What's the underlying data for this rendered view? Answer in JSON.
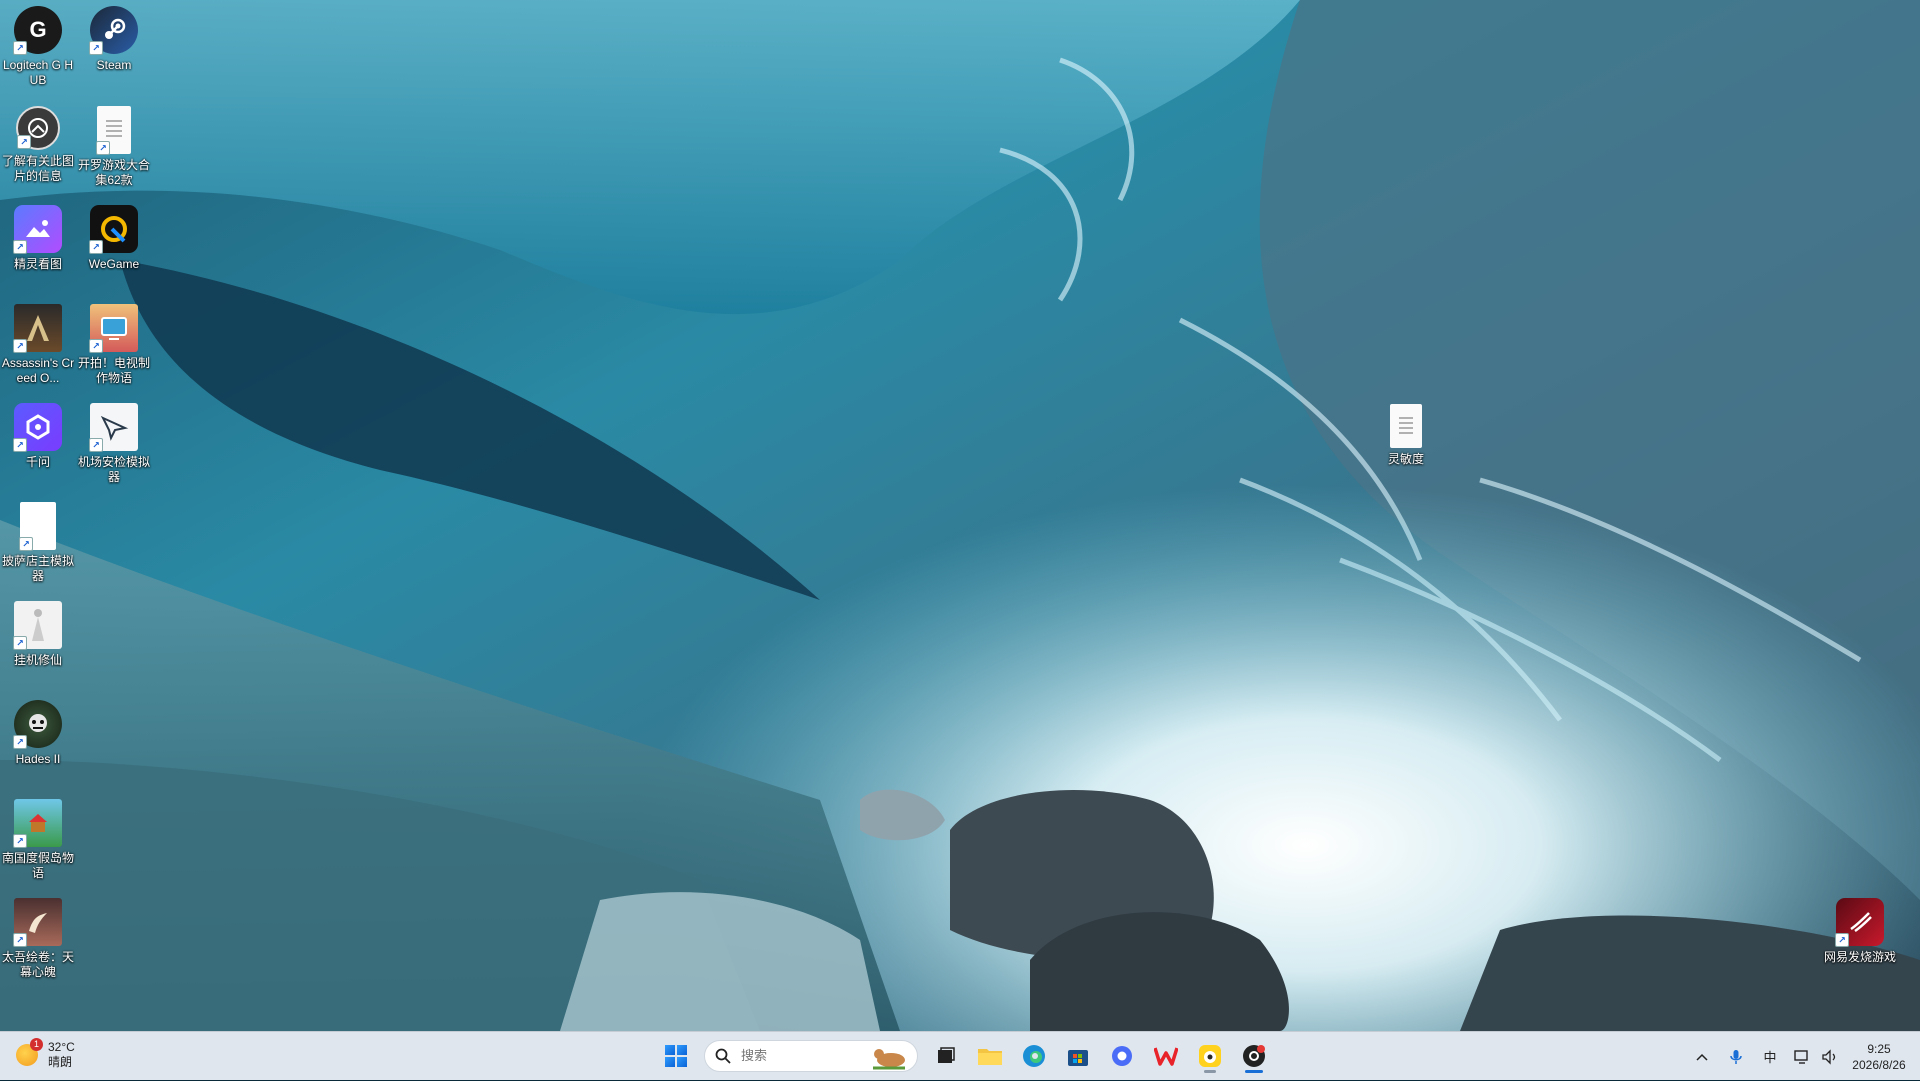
{
  "desktop": {
    "icons": [
      {
        "label": "Logitech G HUB",
        "icon": "logitech-g-hub-icon"
      },
      {
        "label": "Steam",
        "icon": "steam-icon"
      },
      {
        "label": "了解有关此图片的信息",
        "icon": "spotlight-info-icon"
      },
      {
        "label": "开罗游戏大合集62款",
        "icon": "text-file-icon"
      },
      {
        "label": "精灵看图",
        "icon": "image-viewer-icon"
      },
      {
        "label": "WeGame",
        "icon": "wegame-icon"
      },
      {
        "label": "Assassin's Creed O...",
        "icon": "assassins-creed-icon"
      },
      {
        "label": "开拍！电视制作物语",
        "icon": "kairo-tv-game-icon"
      },
      {
        "label": "千问",
        "icon": "qianwen-icon"
      },
      {
        "label": "机场安检模拟器",
        "icon": "airport-simulator-icon"
      },
      {
        "label": "披萨店主模拟器",
        "icon": "blank-file-icon"
      },
      {
        "label": "挂机修仙",
        "icon": "idle-cultivation-icon"
      },
      {
        "label": "Hades II",
        "icon": "hades-icon"
      },
      {
        "label": "南国度假岛物语",
        "icon": "resort-island-icon"
      },
      {
        "label": "太吾绘卷：天幕心魄",
        "icon": "taiwu-icon"
      },
      {
        "label": "灵敏度",
        "icon": "text-file-icon"
      },
      {
        "label": "网易发烧游戏",
        "icon": "netease-game-icon"
      }
    ]
  },
  "taskbar": {
    "weather": {
      "temp": "32°C",
      "condition": "晴朗",
      "badge": "1"
    },
    "search": {
      "placeholder": "搜索"
    },
    "apps": [
      {
        "name": "start",
        "icon": "windows-start-icon"
      },
      {
        "name": "task-view",
        "icon": "task-view-icon"
      },
      {
        "name": "file-explorer",
        "icon": "folder-icon"
      },
      {
        "name": "edge",
        "icon": "edge-icon"
      },
      {
        "name": "store",
        "icon": "microsoft-store-icon"
      },
      {
        "name": "browser",
        "icon": "blue-circle-app-icon"
      },
      {
        "name": "wps",
        "icon": "wps-icon"
      },
      {
        "name": "qq-music",
        "icon": "yellow-app-icon"
      },
      {
        "name": "netease-music",
        "icon": "netease-music-icon"
      }
    ],
    "tray": {
      "chevron": "^",
      "ime": "中",
      "time": "9:25",
      "date": "2026/8/26"
    }
  }
}
